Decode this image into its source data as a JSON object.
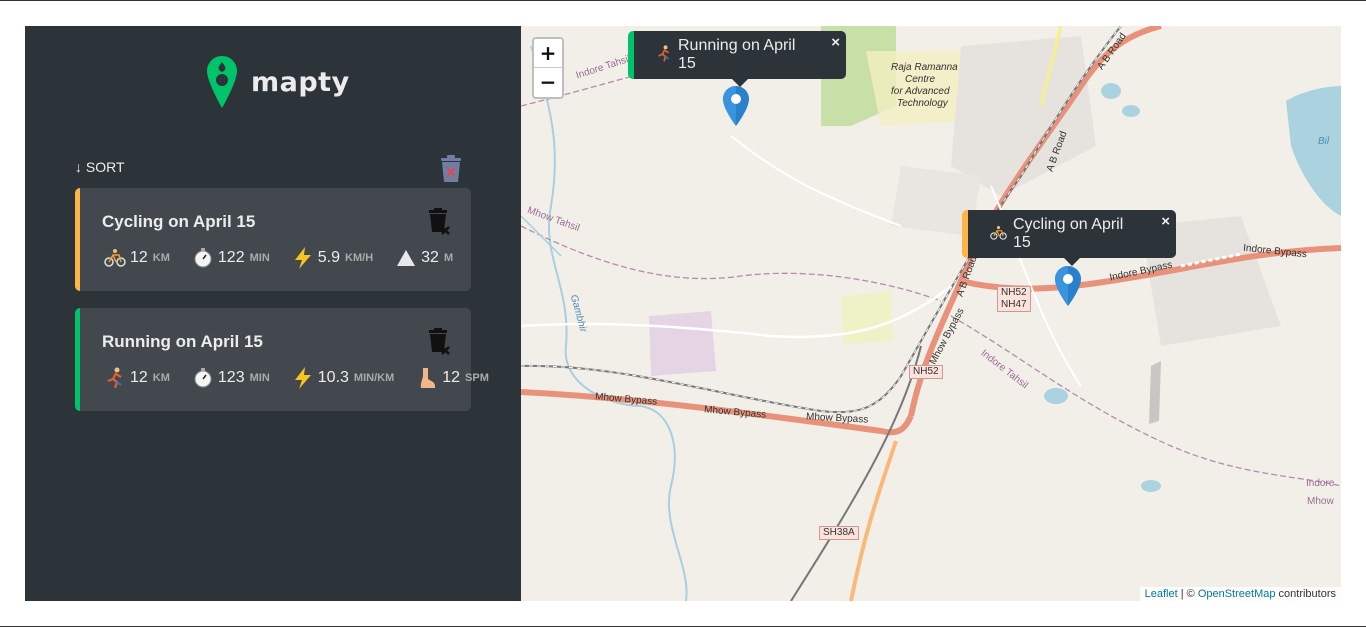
{
  "app": {
    "name": "mapty"
  },
  "sidebar": {
    "sort_label": "↓ SORT",
    "workouts": [
      {
        "type": "cycling",
        "title": "Cycling on April 15",
        "details": [
          {
            "icon": "bicycle-icon",
            "value": "12",
            "unit": "km"
          },
          {
            "icon": "stopwatch-icon",
            "value": "122",
            "unit": "min"
          },
          {
            "icon": "lightning-icon",
            "value": "5.9",
            "unit": "km/h"
          },
          {
            "icon": "mountain-icon",
            "value": "32",
            "unit": "m"
          }
        ]
      },
      {
        "type": "running",
        "title": "Running on April 15",
        "details": [
          {
            "icon": "runner-icon",
            "value": "12",
            "unit": "km"
          },
          {
            "icon": "stopwatch-icon",
            "value": "123",
            "unit": "min"
          },
          {
            "icon": "lightning-icon",
            "value": "10.3",
            "unit": "min/km"
          },
          {
            "icon": "foot-icon",
            "value": "12",
            "unit": "spm"
          }
        ]
      }
    ]
  },
  "map": {
    "zoom_in": "+",
    "zoom_out": "−",
    "popups": [
      {
        "type": "running",
        "label": "Running on April 15",
        "close": "×"
      },
      {
        "type": "cycling",
        "label": "Cycling on April 15",
        "close": "×"
      }
    ],
    "labels": {
      "raja": [
        "Raja Ramanna",
        "Centre",
        "for Advanced",
        "Technology"
      ],
      "indore_tahsil_top": "Indore Tahsil",
      "mhow_tahsil": "Mhow Tahsil",
      "gambhir": "Gambhir",
      "ab_road_1": "A B Road",
      "ab_road_2": "A B Road",
      "ab_road_3": "A B Road",
      "indore_bypass_1": "Indore Bypass",
      "indore_bypass_2": "Indore Bypass",
      "mhow_bypass_1": "Mhow Bypass",
      "mhow_bypass_2": "Mhow Bypass",
      "mhow_bypass_3": "Mhow Bypass",
      "mhow_bypass_4": "Mhow Bypass",
      "indore_tahsil_mid": "Indore Tahsil",
      "indore_right": "Indore",
      "mhow_right": "Mhow",
      "bil": "Bil",
      "shield_nh52_a": "NH52",
      "shield_nh47": "NH47",
      "shield_nh52_b": "NH52",
      "shield_sh38a": "SH38A"
    },
    "attribution": {
      "leaflet": "Leaflet",
      "separator": " | © ",
      "osm": "OpenStreetMap",
      "suffix": " contributors"
    }
  },
  "colors": {
    "sidebar_bg": "#2d3439",
    "card_bg": "#42484d",
    "cycling": "#ffb545",
    "running": "#00c46a",
    "logo_green": "#00c46a",
    "marker_blue": "#2a81cb"
  }
}
